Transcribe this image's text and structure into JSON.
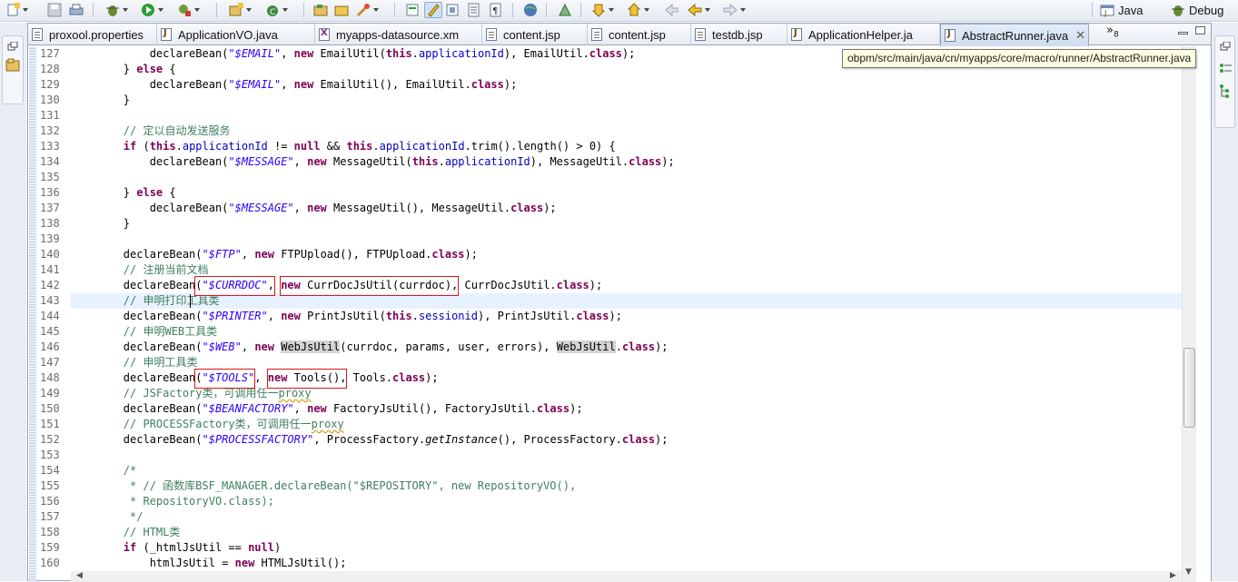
{
  "toolbar": {
    "icons": [
      "new-icon",
      "save-icon",
      "print-icon",
      "debug-icon",
      "run-icon",
      "external-tools-icon",
      "new-java-project-icon",
      "new-class-icon",
      "open-type-icon",
      "open-task-icon",
      "search-icon",
      "toggle-breadcrumb-icon",
      "mark-occurrences-icon",
      "toggle-block-selection-icon",
      "show-whitespace-icon",
      "web-browser-icon",
      "next-annotation-icon",
      "previous-annotation-icon",
      "last-edit-location-icon",
      "back-icon",
      "forward-icon"
    ],
    "perspectives": [
      {
        "label": "Java",
        "icon": "java-perspective-icon"
      },
      {
        "label": "Debug",
        "icon": "debug-perspective-icon"
      }
    ]
  },
  "tabs": [
    {
      "label": "proxool.properties",
      "icon": "properties-file-icon",
      "active": false
    },
    {
      "label": "ApplicationVO.java",
      "icon": "java-file-icon",
      "active": false
    },
    {
      "label": "myapps-datasource.xm",
      "icon": "xml-file-icon",
      "active": false
    },
    {
      "label": "content.jsp",
      "icon": "jsp-file-icon",
      "active": false
    },
    {
      "label": "content.jsp",
      "icon": "jsp-file-icon",
      "active": false
    },
    {
      "label": "testdb.jsp",
      "icon": "jsp-file-icon",
      "active": false
    },
    {
      "label": "ApplicationHelper.ja",
      "icon": "java-file-icon",
      "active": false
    },
    {
      "label": "AbstractRunner.java",
      "icon": "java-file-icon",
      "active": true,
      "close": "✕"
    }
  ],
  "tab_overflow": {
    "label": "»",
    "count": "8"
  },
  "tooltip": "obpm/src/main/java/cn/myapps/core/macro/runner/AbstractRunner.java",
  "editor": {
    "line_numbers": [
      "127",
      "128",
      "129",
      "130",
      "131",
      "132",
      "133",
      "134",
      "135",
      "136",
      "137",
      "138",
      "139",
      "140",
      "141",
      "142",
      "143",
      "144",
      "145",
      "146",
      "147",
      "148",
      "149",
      "150",
      "151",
      "152",
      "153",
      "154",
      "155",
      "156",
      "157",
      "158",
      "159",
      "160"
    ],
    "current_line": "143",
    "lines": [
      "            declareBean(\"$EMAIL\", new EmailUtil(this.applicationId), EmailUtil.class);",
      "        } else {",
      "            declareBean(\"$EMAIL\", new EmailUtil(), EmailUtil.class);",
      "        }",
      "",
      "        // 定以自动发送服务",
      "        if (this.applicationId != null && this.applicationId.trim().length() > 0) {",
      "            declareBean(\"$MESSAGE\", new MessageUtil(this.applicationId), MessageUtil.class);",
      "",
      "        } else {",
      "            declareBean(\"$MESSAGE\", new MessageUtil(), MessageUtil.class);",
      "        }",
      "",
      "        declareBean(\"$FTP\", new FTPUpload(), FTPUpload.class);",
      "        // 注册当前文档",
      "        declareBean(\"$CURRDOC\", new CurrDocJsUtil(currdoc), CurrDocJsUtil.class);",
      "        // 申明打印工具类",
      "        declareBean(\"$PRINTER\", new PrintJsUtil(this.sessionid), PrintJsUtil.class);",
      "        // 申明WEB工具类",
      "        declareBean(\"$WEB\", new WebJsUtil(currdoc, params, user, errors), WebJsUtil.class);",
      "        // 申明工具类",
      "        declareBean(\"$TOOLS\", new Tools(), Tools.class);",
      "        // JSFactory类，可调用任一proxy",
      "        declareBean(\"$BEANFACTORY\", new FactoryJsUtil(), FactoryJsUtil.class);",
      "        // PROCESSFactory类，可调用任一proxy",
      "        declareBean(\"$PROCESSFACTORY\", ProcessFactory.getInstance(), ProcessFactory.class);",
      "",
      "        /*",
      "         * // 函数库BSF_MANAGER.declareBean(\"$REPOSITORY\", new RepositoryVO(),",
      "         * RepositoryVO.class);",
      "         */",
      "        // HTML类",
      "        if (_htmlJsUtil == null)",
      "            htmlJsUtil = new HTMLJsUtil();"
    ]
  }
}
